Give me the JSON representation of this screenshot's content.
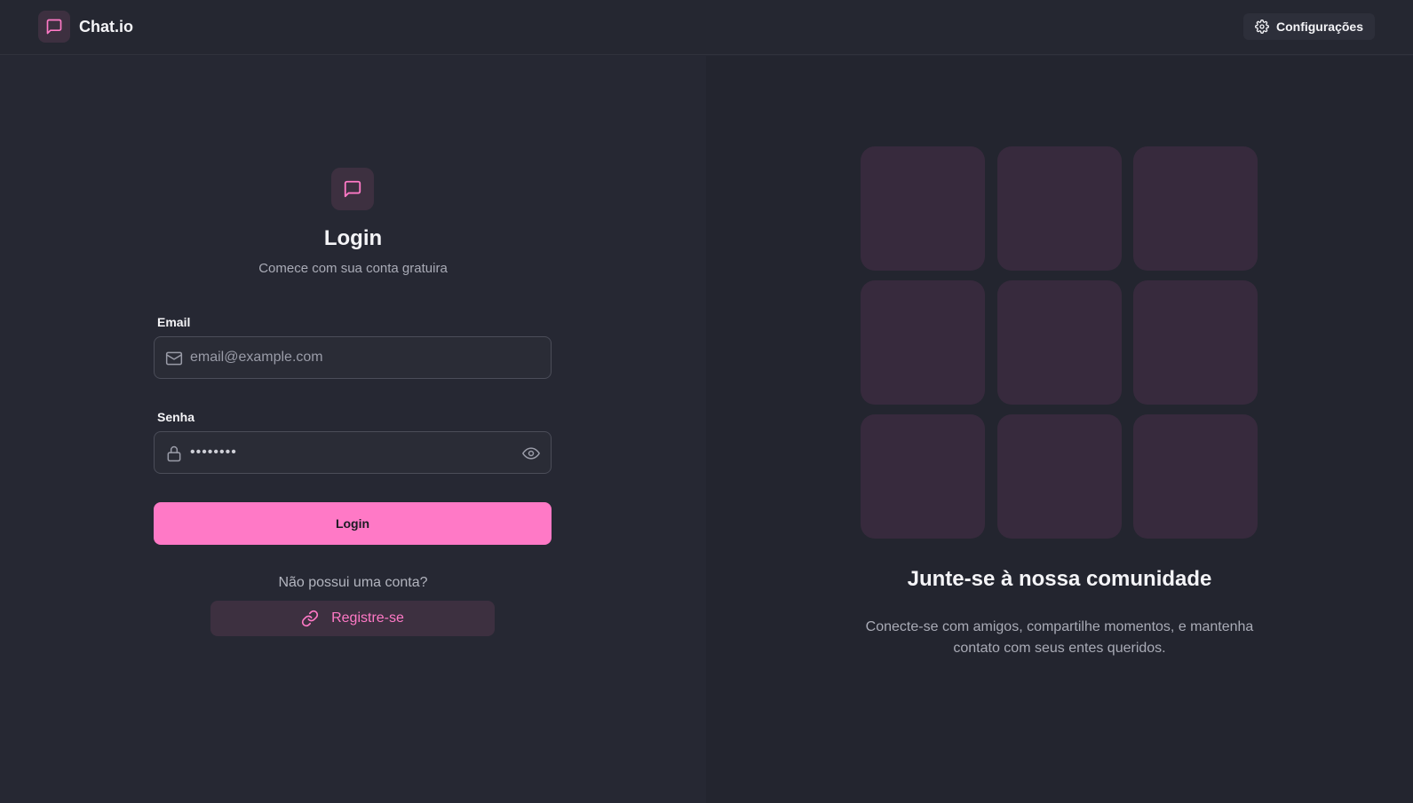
{
  "header": {
    "brand_name": "Chat.io",
    "brand_icon": "message-square-icon",
    "settings_label": "Configurações",
    "settings_icon": "gear-icon"
  },
  "login_form": {
    "icon": "message-square-icon",
    "title": "Login",
    "subtitle": "Comece com sua conta gratuira",
    "email": {
      "label": "Email",
      "placeholder": "email@example.com",
      "value": "",
      "icon": "mail-icon"
    },
    "password": {
      "label": "Senha",
      "value": "••••••••",
      "icon": "lock-icon",
      "toggle_icon": "eye-icon"
    },
    "submit_label": "Login",
    "no_account_text": "Não possui uma conta?",
    "register_label": "Registre-se",
    "register_icon": "link-icon"
  },
  "promo": {
    "tile_count": 9,
    "title": "Junte-se à nossa comunidade",
    "text": "Conecte-se com amigos, compartilhe momentos, e mantenha contato com seus entes queridos."
  },
  "colors": {
    "background": "#262833",
    "accent": "#ff79c6",
    "accent_soft": "#3d3040",
    "tile": "#372a3d"
  }
}
